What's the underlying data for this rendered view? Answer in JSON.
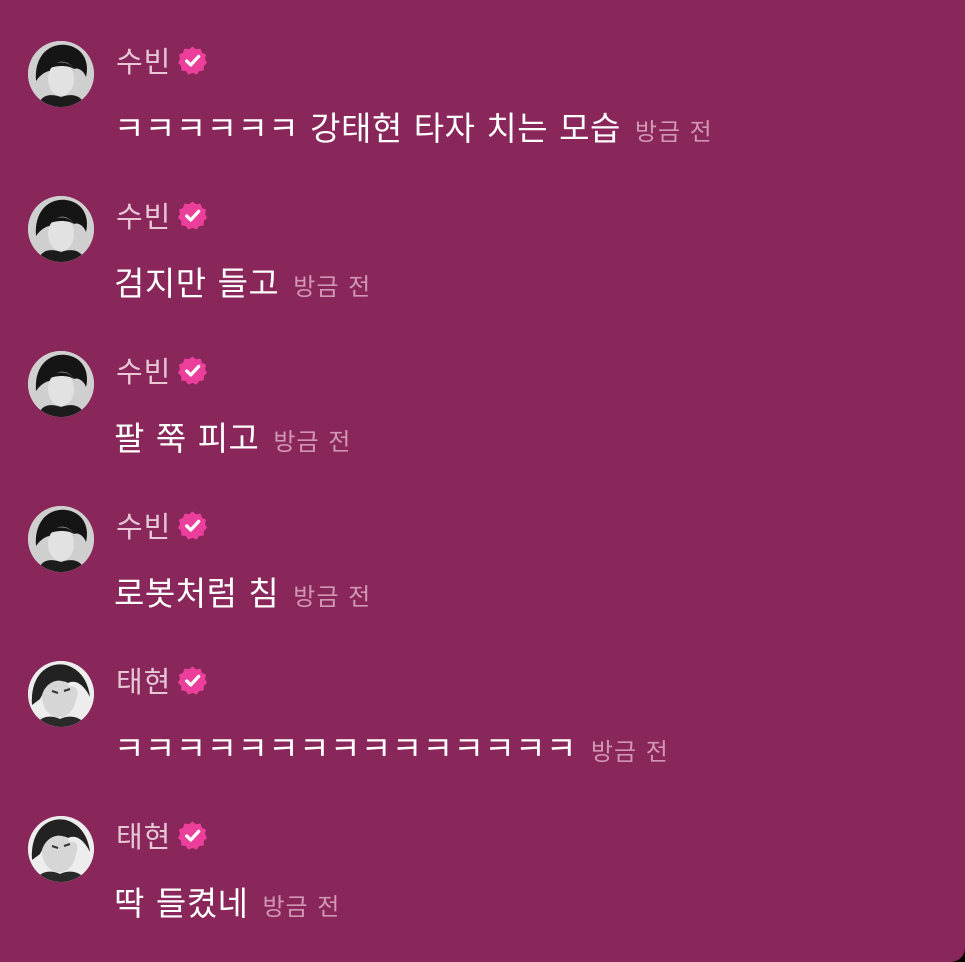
{
  "colors": {
    "background": "#89265a",
    "message_text": "#ffffff",
    "name_text": "#e7c6d6",
    "time_text": "#d196b4",
    "verified_badge": "#ec3f9c"
  },
  "messages": [
    {
      "avatar": "avatar-subin",
      "name": "수빈",
      "badge": "verified-badge-icon",
      "text": "ㅋㅋㅋㅋㅋㅋ 강태현 타자 치는 모습",
      "time": "방금 전"
    },
    {
      "avatar": "avatar-subin",
      "name": "수빈",
      "badge": "verified-badge-icon",
      "text": "검지만 들고",
      "time": "방금 전"
    },
    {
      "avatar": "avatar-subin",
      "name": "수빈",
      "badge": "verified-badge-icon",
      "text": "팔 쭉 피고",
      "time": "방금 전"
    },
    {
      "avatar": "avatar-subin",
      "name": "수빈",
      "badge": "verified-badge-icon",
      "text": "로봇처럼 침",
      "time": "방금 전"
    },
    {
      "avatar": "avatar-taehyun",
      "name": "태현",
      "badge": "verified-badge-icon",
      "text": "ㅋㅋㅋㅋㅋㅋㅋㅋㅋㅋㅋㅋㅋㅋㅋ",
      "time": "방금 전"
    },
    {
      "avatar": "avatar-taehyun",
      "name": "태현",
      "badge": "verified-badge-icon",
      "text": "딱 들켰네",
      "time": "방금 전"
    }
  ]
}
